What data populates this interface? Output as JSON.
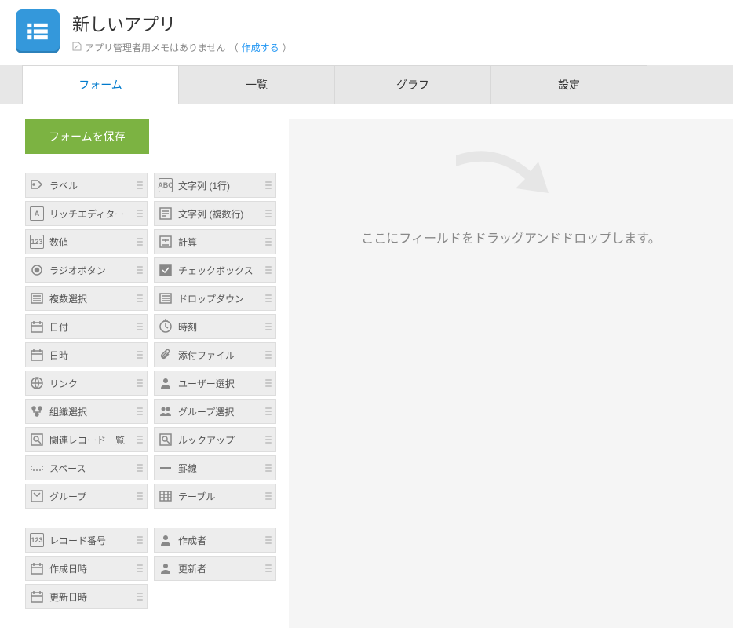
{
  "header": {
    "title": "新しいアプリ",
    "memo_label": "アプリ管理者用メモはありません",
    "memo_create": "作成する"
  },
  "tabs": {
    "form": "フォーム",
    "list": "一覧",
    "graph": "グラフ",
    "settings": "設定"
  },
  "sidebar": {
    "save_button": "フォームを保存"
  },
  "fields": {
    "left": [
      "ラベル",
      "リッチエディター",
      "数値",
      "ラジオボタン",
      "複数選択",
      "日付",
      "日時",
      "リンク",
      "組織選択",
      "関連レコード一覧",
      "スペース",
      "グループ"
    ],
    "right": [
      "文字列 (1行)",
      "文字列 (複数行)",
      "計算",
      "チェックボックス",
      "ドロップダウン",
      "時刻",
      "添付ファイル",
      "ユーザー選択",
      "グループ選択",
      "ルックアップ",
      "罫線",
      "テーブル"
    ],
    "system_left": [
      "レコード番号",
      "作成日時",
      "更新日時"
    ],
    "system_right": [
      "作成者",
      "更新者"
    ]
  },
  "canvas": {
    "placeholder": "ここにフィールドをドラッグアンドドロップします。"
  }
}
